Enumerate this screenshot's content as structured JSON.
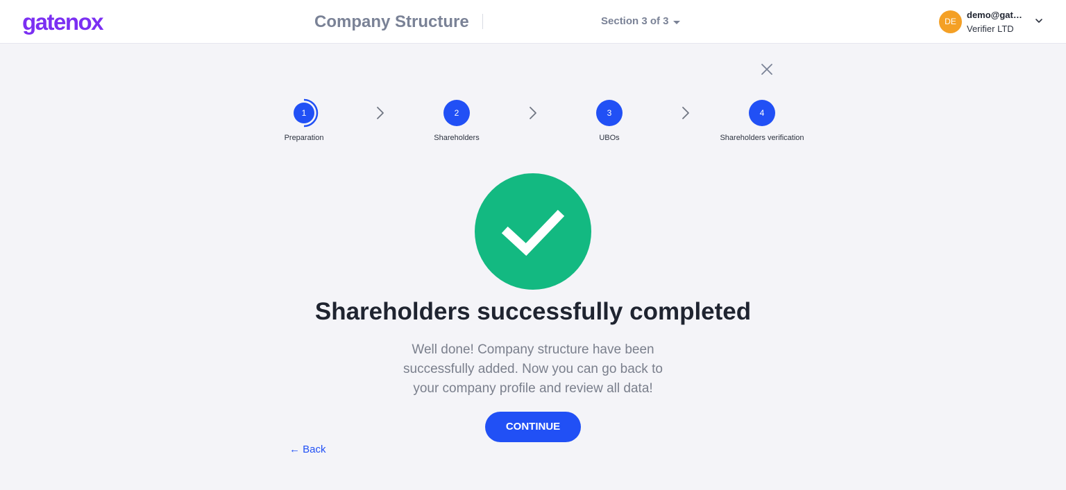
{
  "header": {
    "logo_text": "gatenox",
    "page_title": "Company Structure",
    "section_label": "Section 3 of 3",
    "user": {
      "initials": "DE",
      "email": "demo@gatenox.com",
      "company": "Verifier LTD"
    }
  },
  "stepper": {
    "steps": [
      {
        "number": "1",
        "label": "Preparation"
      },
      {
        "number": "2",
        "label": "Shareholders"
      },
      {
        "number": "3",
        "label": "UBOs"
      },
      {
        "number": "4",
        "label": "Shareholders verification"
      }
    ]
  },
  "success": {
    "title": "Shareholders successfully completed",
    "message": "Well done! Company structure have been successfully added. Now you can go back to your company profile and review all data!",
    "continue_label": "CONTINUE",
    "back_label": "← Back"
  },
  "colors": {
    "brand": "#7b2ff2",
    "primary": "#2150f5",
    "success": "#13b981",
    "avatar": "#f4a025"
  },
  "icons": [
    "caret-down-icon",
    "chevron-down-icon",
    "close-icon",
    "chevron-right-icon",
    "checkmark-icon"
  ]
}
